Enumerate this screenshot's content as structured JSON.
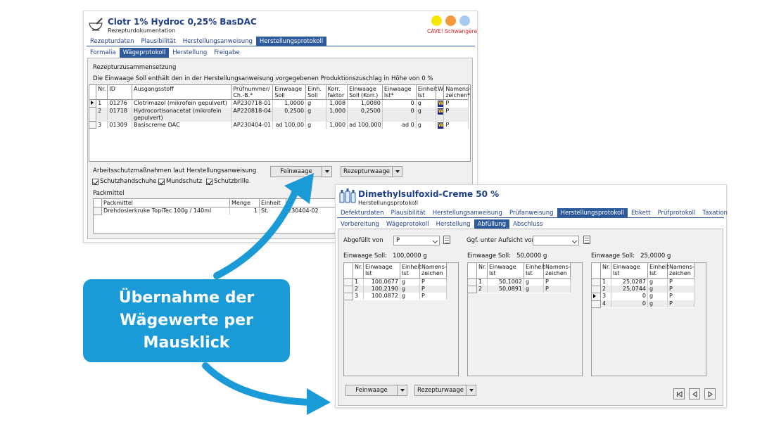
{
  "colors": {
    "accent": "#2e5a9c",
    "callout": "#1a9ad6",
    "arrow": "#1a9ad6",
    "dot_yellow": "#f7e600",
    "dot_orange": "#f59a3a",
    "dot_blue": "#a8cbf2",
    "warning": "#d02020"
  },
  "callout": {
    "line1": "Übernahme der",
    "line2": "Wägewerte per",
    "line3": "Mausklick"
  },
  "win1": {
    "icon": "mortar-pestle-icon",
    "title": "Clotr 1% Hydroc 0,25% BasDAC",
    "subtitle": "Rezepturdokumentation",
    "warning": "CAVE! Schwangere",
    "tabs": [
      "Rezepturdaten",
      "Plausibilität",
      "Herstellungsanweisung",
      "Herstellungsprotokoll"
    ],
    "subtabs": [
      "Formalia",
      "Wägeprotokoll",
      "Herstellung",
      "Freigabe"
    ],
    "section_title": "Rezepturzusammensetzung",
    "info": "Die Einwaage Soll enthält den in der Herstellungsanweisung vorgegebenen Produktionszuschlag in Höhe von 0 %",
    "columns": [
      "Nr.",
      "ID",
      "Ausgangsstoff",
      "Prüfnummer/ Ch.-B.*",
      "Einwaage Soll",
      "Einh. Soll",
      "Korr. faktor",
      "Einwaage Soll (Korr.)",
      "Einwaage Ist*",
      "Einheit Ist",
      "W",
      "Namens- zeichen*"
    ],
    "rows": [
      {
        "nr": "1",
        "id": "01276",
        "name": "Clotrimazol (mikrofein gepulvert)",
        "pruef": "AP230718-01",
        "soll": "1,0000",
        "einh": "g",
        "korr": "1,008",
        "sollkorr": "1,0080",
        "ist": "0",
        "einhist": "g",
        "w": "W",
        "nz": "P"
      },
      {
        "nr": "2",
        "id": "01718",
        "name": "Hydrocortisonacetat (mikrofein",
        "name2": "gepulvert)",
        "pruef": "AP220818-04",
        "soll": "0,2500",
        "einh": "g",
        "korr": "1,000",
        "sollkorr": "0,2500",
        "ist": "0",
        "einhist": "g",
        "w": "W",
        "nz": "P"
      },
      {
        "nr": "3",
        "id": "01309",
        "name": "Basiscreme DAC",
        "pruef": "AP230404-01",
        "soll": "ad 100,00",
        "einh": "g",
        "korr": "1,000",
        "sollkorr": "ad 100,000",
        "ist": "ad 0",
        "einhist": "g",
        "w": "W",
        "nz": "P"
      }
    ],
    "arbeitsschutz_label": "Arbeitsschutzmaßnahmen laut Herstellungsanweisung",
    "checkboxes": [
      "Schutzhandschuhe",
      "Mundschutz",
      "Schutzbrille"
    ],
    "btn_feinwaage": "Feinwaage",
    "btn_rezepturwaage": "Rezepturwaage",
    "packmittel_label": "Packmittel",
    "pack_columns": [
      "Packmittel",
      "Menge",
      "Einheit",
      "P"
    ],
    "pack_row": {
      "name": "Drehdosierkruke TopiTec  100g / 140ml",
      "menge": "1",
      "einheit": "St.",
      "p": "230404-02"
    }
  },
  "win2": {
    "icon": "bottles-icon",
    "title": "Dimethylsulfoxid-Creme 50 %",
    "subtitle": "Herstellungsprotokoll",
    "tabs": [
      "Defekturdaten",
      "Plausibilität",
      "Herstellungsanweisung",
      "Prüfanweisung",
      "Herstellungsprotokoll",
      "Etikett",
      "Prüfprotokoll",
      "Taxation"
    ],
    "subtabs": [
      "Vorbereitung",
      "Wägeprotokoll",
      "Herstellung",
      "Abfüllung",
      "Abschluss"
    ],
    "abgefuellt_label": "Abgefüllt von",
    "abgefuellt_value": "P",
    "aufsicht_label": "Ggf. unter Aufsicht von",
    "aufsicht_value": "",
    "columns": [
      "Nr.",
      "Einwaage Ist",
      "Einheit Ist",
      "Namens- zeichen"
    ],
    "groups": [
      {
        "soll_label": "Einwaage Soll:",
        "soll_value": "100,0000 g",
        "rows": [
          {
            "nr": "1",
            "ist": "100,0677",
            "einh": "g",
            "nz": "P"
          },
          {
            "nr": "2",
            "ist": "100,2190",
            "einh": "g",
            "nz": "P"
          },
          {
            "nr": "3",
            "ist": "100,0872",
            "einh": "g",
            "nz": "P"
          }
        ]
      },
      {
        "soll_label": "Einwaage Soll:",
        "soll_value": "50,0000 g",
        "rows": [
          {
            "nr": "1",
            "ist": "50,1002",
            "einh": "g",
            "nz": "P"
          },
          {
            "nr": "2",
            "ist": "50,0891",
            "einh": "g",
            "nz": "P"
          }
        ]
      },
      {
        "soll_label": "Einwaage Soll:",
        "soll_value": "25,0000 g",
        "rows": [
          {
            "nr": "1",
            "ist": "25,0287",
            "einh": "g",
            "nz": "P"
          },
          {
            "nr": "2",
            "ist": "25,0744",
            "einh": "g",
            "nz": "P"
          },
          {
            "nr": "3",
            "ist": "0",
            "einh": "g",
            "nz": "P"
          },
          {
            "nr": "4",
            "ist": "0",
            "einh": "g",
            "nz": "P"
          }
        ]
      }
    ],
    "btn_feinwaage": "Feinwaage",
    "btn_rezepturwaage": "Rezepturwaage",
    "nav": [
      "first-page-icon",
      "prev-page-icon",
      "next-page-icon"
    ]
  }
}
